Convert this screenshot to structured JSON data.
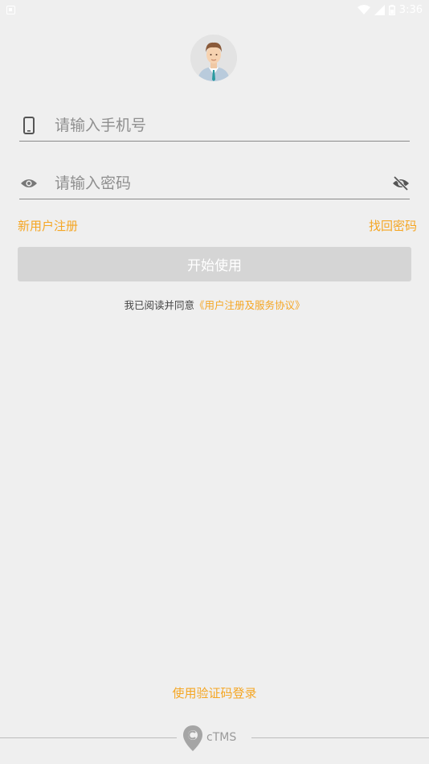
{
  "status_bar": {
    "time": "3:36"
  },
  "login": {
    "phone_placeholder": "请输入手机号",
    "password_placeholder": "请输入密码",
    "register_link": "新用户注册",
    "forgot_link": "找回密码",
    "start_button": "开始使用",
    "agreement_prefix": "我已阅读并同意",
    "agreement_link": "《用户注册及服务协议》",
    "sms_login": "使用验证码登录"
  },
  "footer": {
    "logo_text": "cTMS"
  },
  "colors": {
    "accent": "#f5a623",
    "background": "#efefef",
    "button_disabled": "#d5d5d5"
  }
}
